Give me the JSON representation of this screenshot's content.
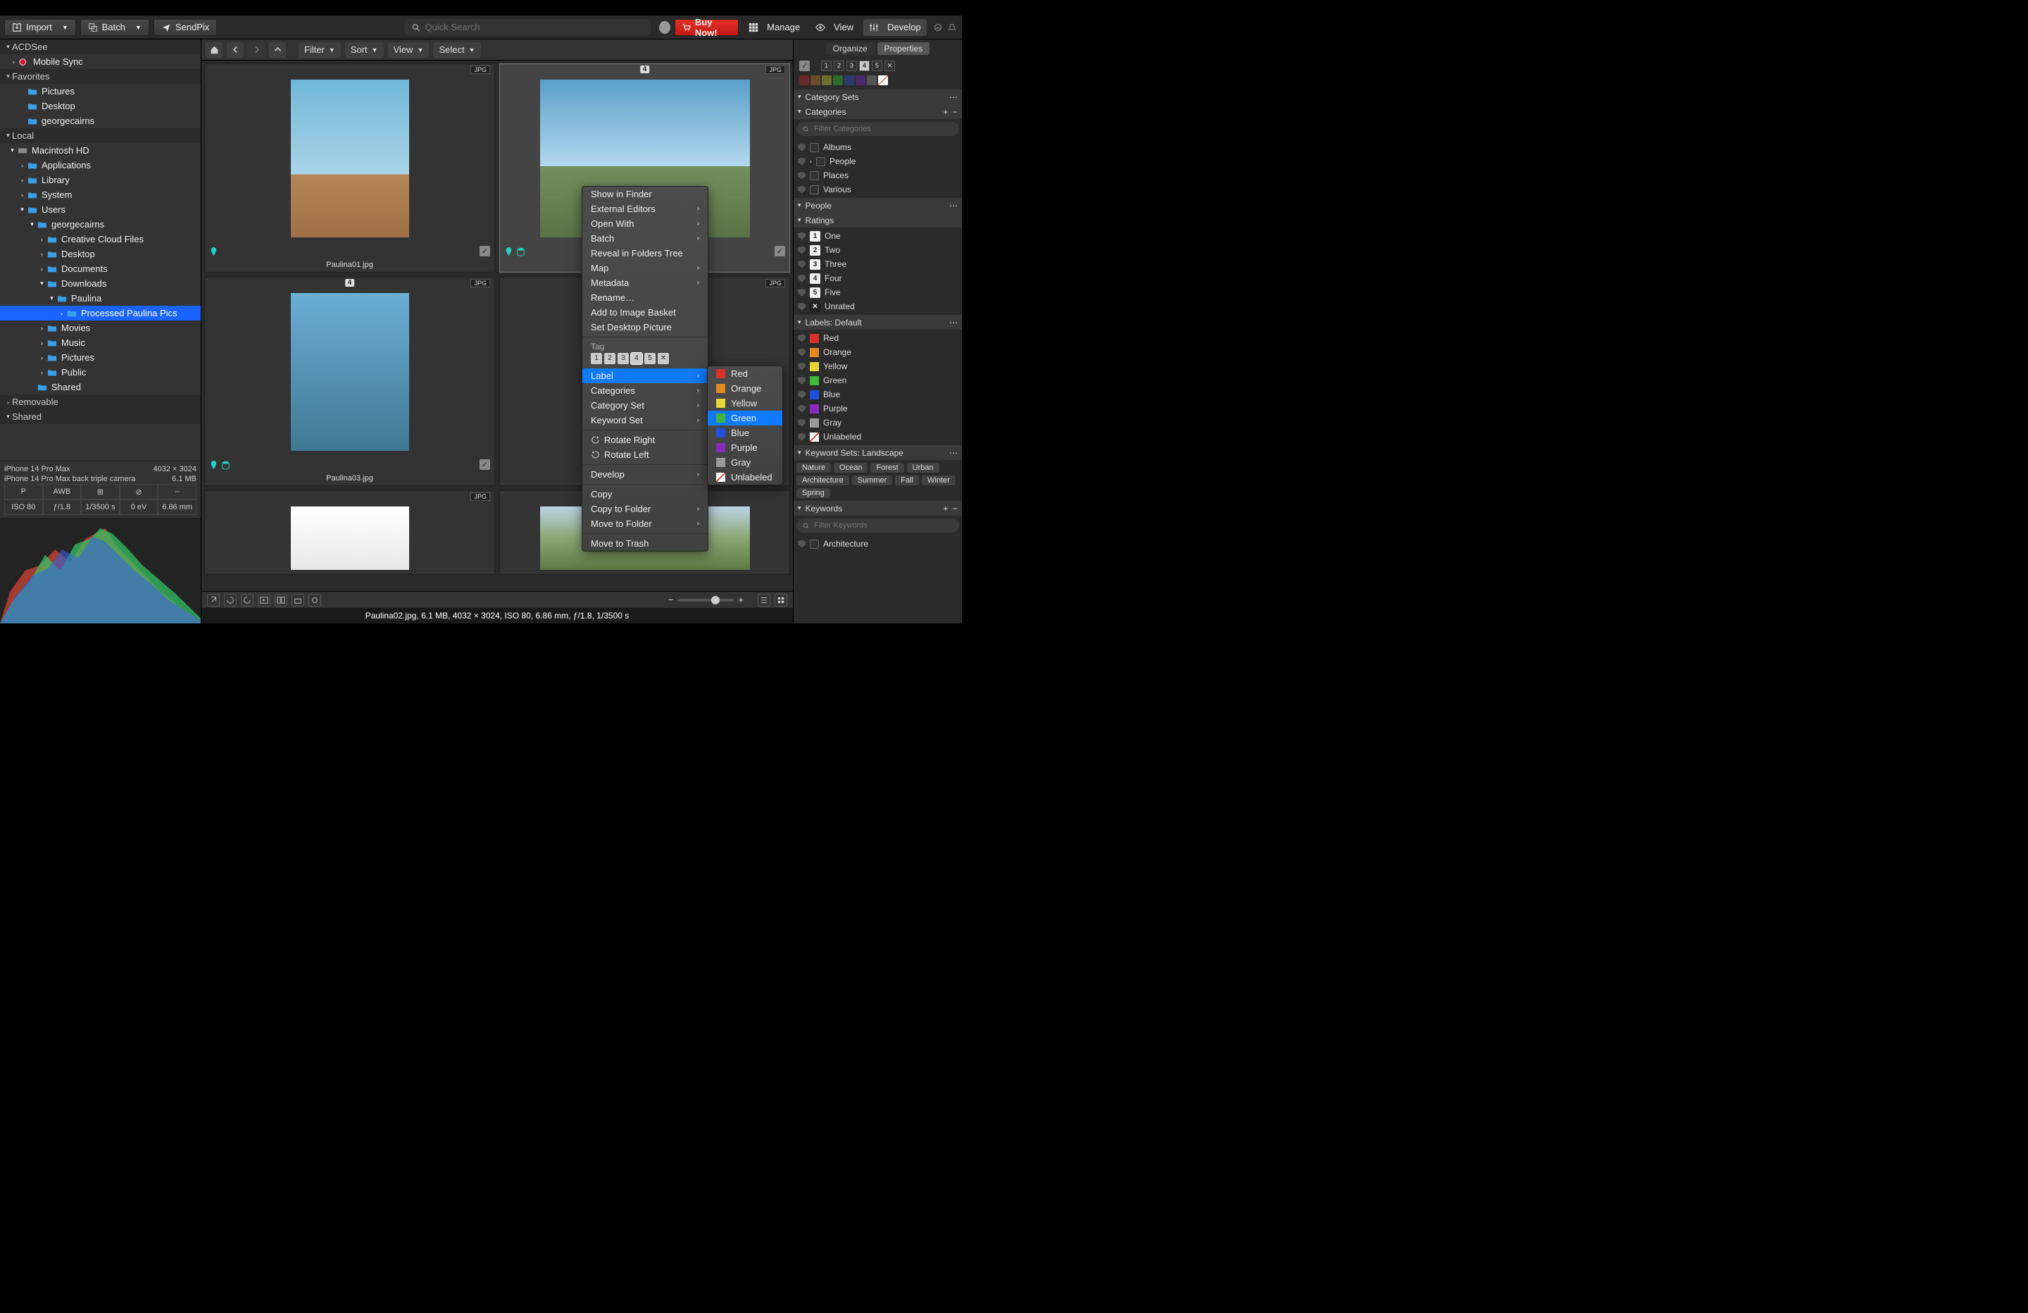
{
  "toolbar": {
    "import": "Import",
    "batch": "Batch",
    "sendpix": "SendPix",
    "search_ph": "Quick Search",
    "buy": "Buy Now!",
    "manage": "Manage",
    "view": "View",
    "develop": "Develop"
  },
  "tree": {
    "acdsee": "ACDSee",
    "mobile": "Mobile Sync",
    "favorites": "Favorites",
    "fav_items": [
      "Pictures",
      "Desktop",
      "georgecairns"
    ],
    "local": "Local",
    "hd": "Macintosh HD",
    "hd_items": [
      "Applications",
      "Library",
      "System"
    ],
    "users": "Users",
    "user": "georgecairns",
    "user_items1": [
      "Creative Cloud Files",
      "Desktop",
      "Documents"
    ],
    "downloads": "Downloads",
    "paulina": "Paulina",
    "processed": "Processed Paulina Pics",
    "user_items2": [
      "Movies",
      "Music",
      "Pictures",
      "Public"
    ],
    "shared_f": "Shared",
    "removable": "Removable",
    "shared": "Shared"
  },
  "info": {
    "cam": "iPhone 14 Pro Max",
    "dim": "4032 × 3024",
    "lens": "iPhone 14 Pro Max back triple camera",
    "size": "6.1 MB",
    "cells": [
      "P",
      "AWB",
      "⊞",
      "⊘",
      "--",
      "ISO 80",
      "ƒ/1.8",
      "1/3500 s",
      "0 eV",
      "6.86 mm"
    ]
  },
  "nav": {
    "filter": "Filter",
    "sort": "Sort",
    "view": "View",
    "select": "Select"
  },
  "thumbs": {
    "jpg": "JPG",
    "names": [
      "Paulina01.jpg",
      "Paulina02.jpg",
      "Paulina03.jpg",
      "",
      "",
      ""
    ],
    "rate4": "4"
  },
  "status": "Paulina02.jpg, 6.1 MB, 4032 × 3024, ISO 80, 6.86 mm, ƒ/1.8, 1/3500 s",
  "right": {
    "organize": "Organize",
    "properties": "Properties",
    "catsets": "Category Sets",
    "categories": "Categories",
    "filter_cat_ph": "Filter Categories",
    "cat_items": [
      "Albums",
      "People",
      "Places",
      "Various"
    ],
    "people": "People",
    "ratings": "Ratings",
    "rating_items": [
      "One",
      "Two",
      "Three",
      "Four",
      "Five",
      "Unrated"
    ],
    "labels": "Labels: Default",
    "label_items": [
      {
        "n": "Red",
        "c": "#d9312a"
      },
      {
        "n": "Orange",
        "c": "#e18a1f"
      },
      {
        "n": "Yellow",
        "c": "#e7d538"
      },
      {
        "n": "Green",
        "c": "#3fb63c"
      },
      {
        "n": "Blue",
        "c": "#1f4fe0"
      },
      {
        "n": "Purple",
        "c": "#8a2bbf"
      },
      {
        "n": "Gray",
        "c": "#9a9a9a"
      },
      {
        "n": "Unlabeled",
        "c": ""
      }
    ],
    "kwsets": "Keyword Sets: Landscape",
    "kw_tags": [
      "Nature",
      "Ocean",
      "Forest",
      "Urban",
      "Architecture",
      "Summer",
      "Fall",
      "Winter",
      "Spring"
    ],
    "keywords": "Keywords",
    "filter_kw_ph": "Filter Keywords",
    "kw_item": "Architecture"
  },
  "ctx": {
    "items1": [
      "Show in Finder"
    ],
    "items_sub": [
      {
        "t": "External Editors",
        "a": true
      },
      {
        "t": "Open With",
        "a": true
      },
      {
        "t": "Batch",
        "a": true
      }
    ],
    "reveal": "Reveal in Folders Tree",
    "items2": [
      {
        "t": "Map",
        "a": true
      },
      {
        "t": "Metadata",
        "a": true
      },
      {
        "t": "Rename…",
        "a": false
      },
      {
        "t": "Add to Image Basket",
        "a": false
      },
      {
        "t": "Set Desktop Picture",
        "a": false
      }
    ],
    "tag": "Tag",
    "items3": [
      {
        "t": "Label",
        "a": true,
        "hl": true
      },
      {
        "t": "Categories",
        "a": true
      },
      {
        "t": "Category Set",
        "a": true
      },
      {
        "t": "Keyword Set",
        "a": true
      }
    ],
    "rotate_r": "Rotate Right",
    "rotate_l": "Rotate Left",
    "develop": "Develop",
    "copy": "Copy",
    "copy_to": "Copy to Folder",
    "move_to": "Move to Folder",
    "trash": "Move to Trash",
    "labels": [
      {
        "n": "Red",
        "c": "#d9312a"
      },
      {
        "n": "Orange",
        "c": "#e18a1f"
      },
      {
        "n": "Yellow",
        "c": "#e7d538"
      },
      {
        "n": "Green",
        "c": "#3fb63c",
        "hl": true
      },
      {
        "n": "Blue",
        "c": "#1f4fe0"
      },
      {
        "n": "Purple",
        "c": "#8a2bbf"
      },
      {
        "n": "Gray",
        "c": "#9a9a9a"
      },
      {
        "n": "Unlabeled",
        "c": ""
      }
    ]
  }
}
